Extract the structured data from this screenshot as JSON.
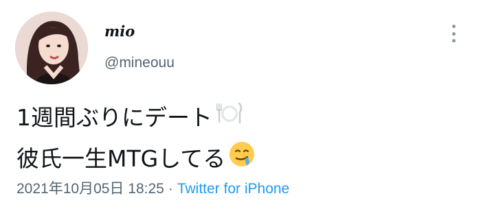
{
  "user": {
    "display_name": "mio",
    "handle": "@mineouu"
  },
  "tweet": {
    "line1": "1週間ぶりにデート",
    "line1_emoji": "fork-knife-plate-icon",
    "line2": "彼氏一生MTGしてる",
    "line2_emoji": "drooling-face-icon",
    "timestamp": "2021年10月05日 18:25",
    "separator": "·",
    "source": "Twitter for iPhone"
  },
  "colors": {
    "text": "#0f1419",
    "secondary": "#536471",
    "link": "#1d9bf0"
  }
}
